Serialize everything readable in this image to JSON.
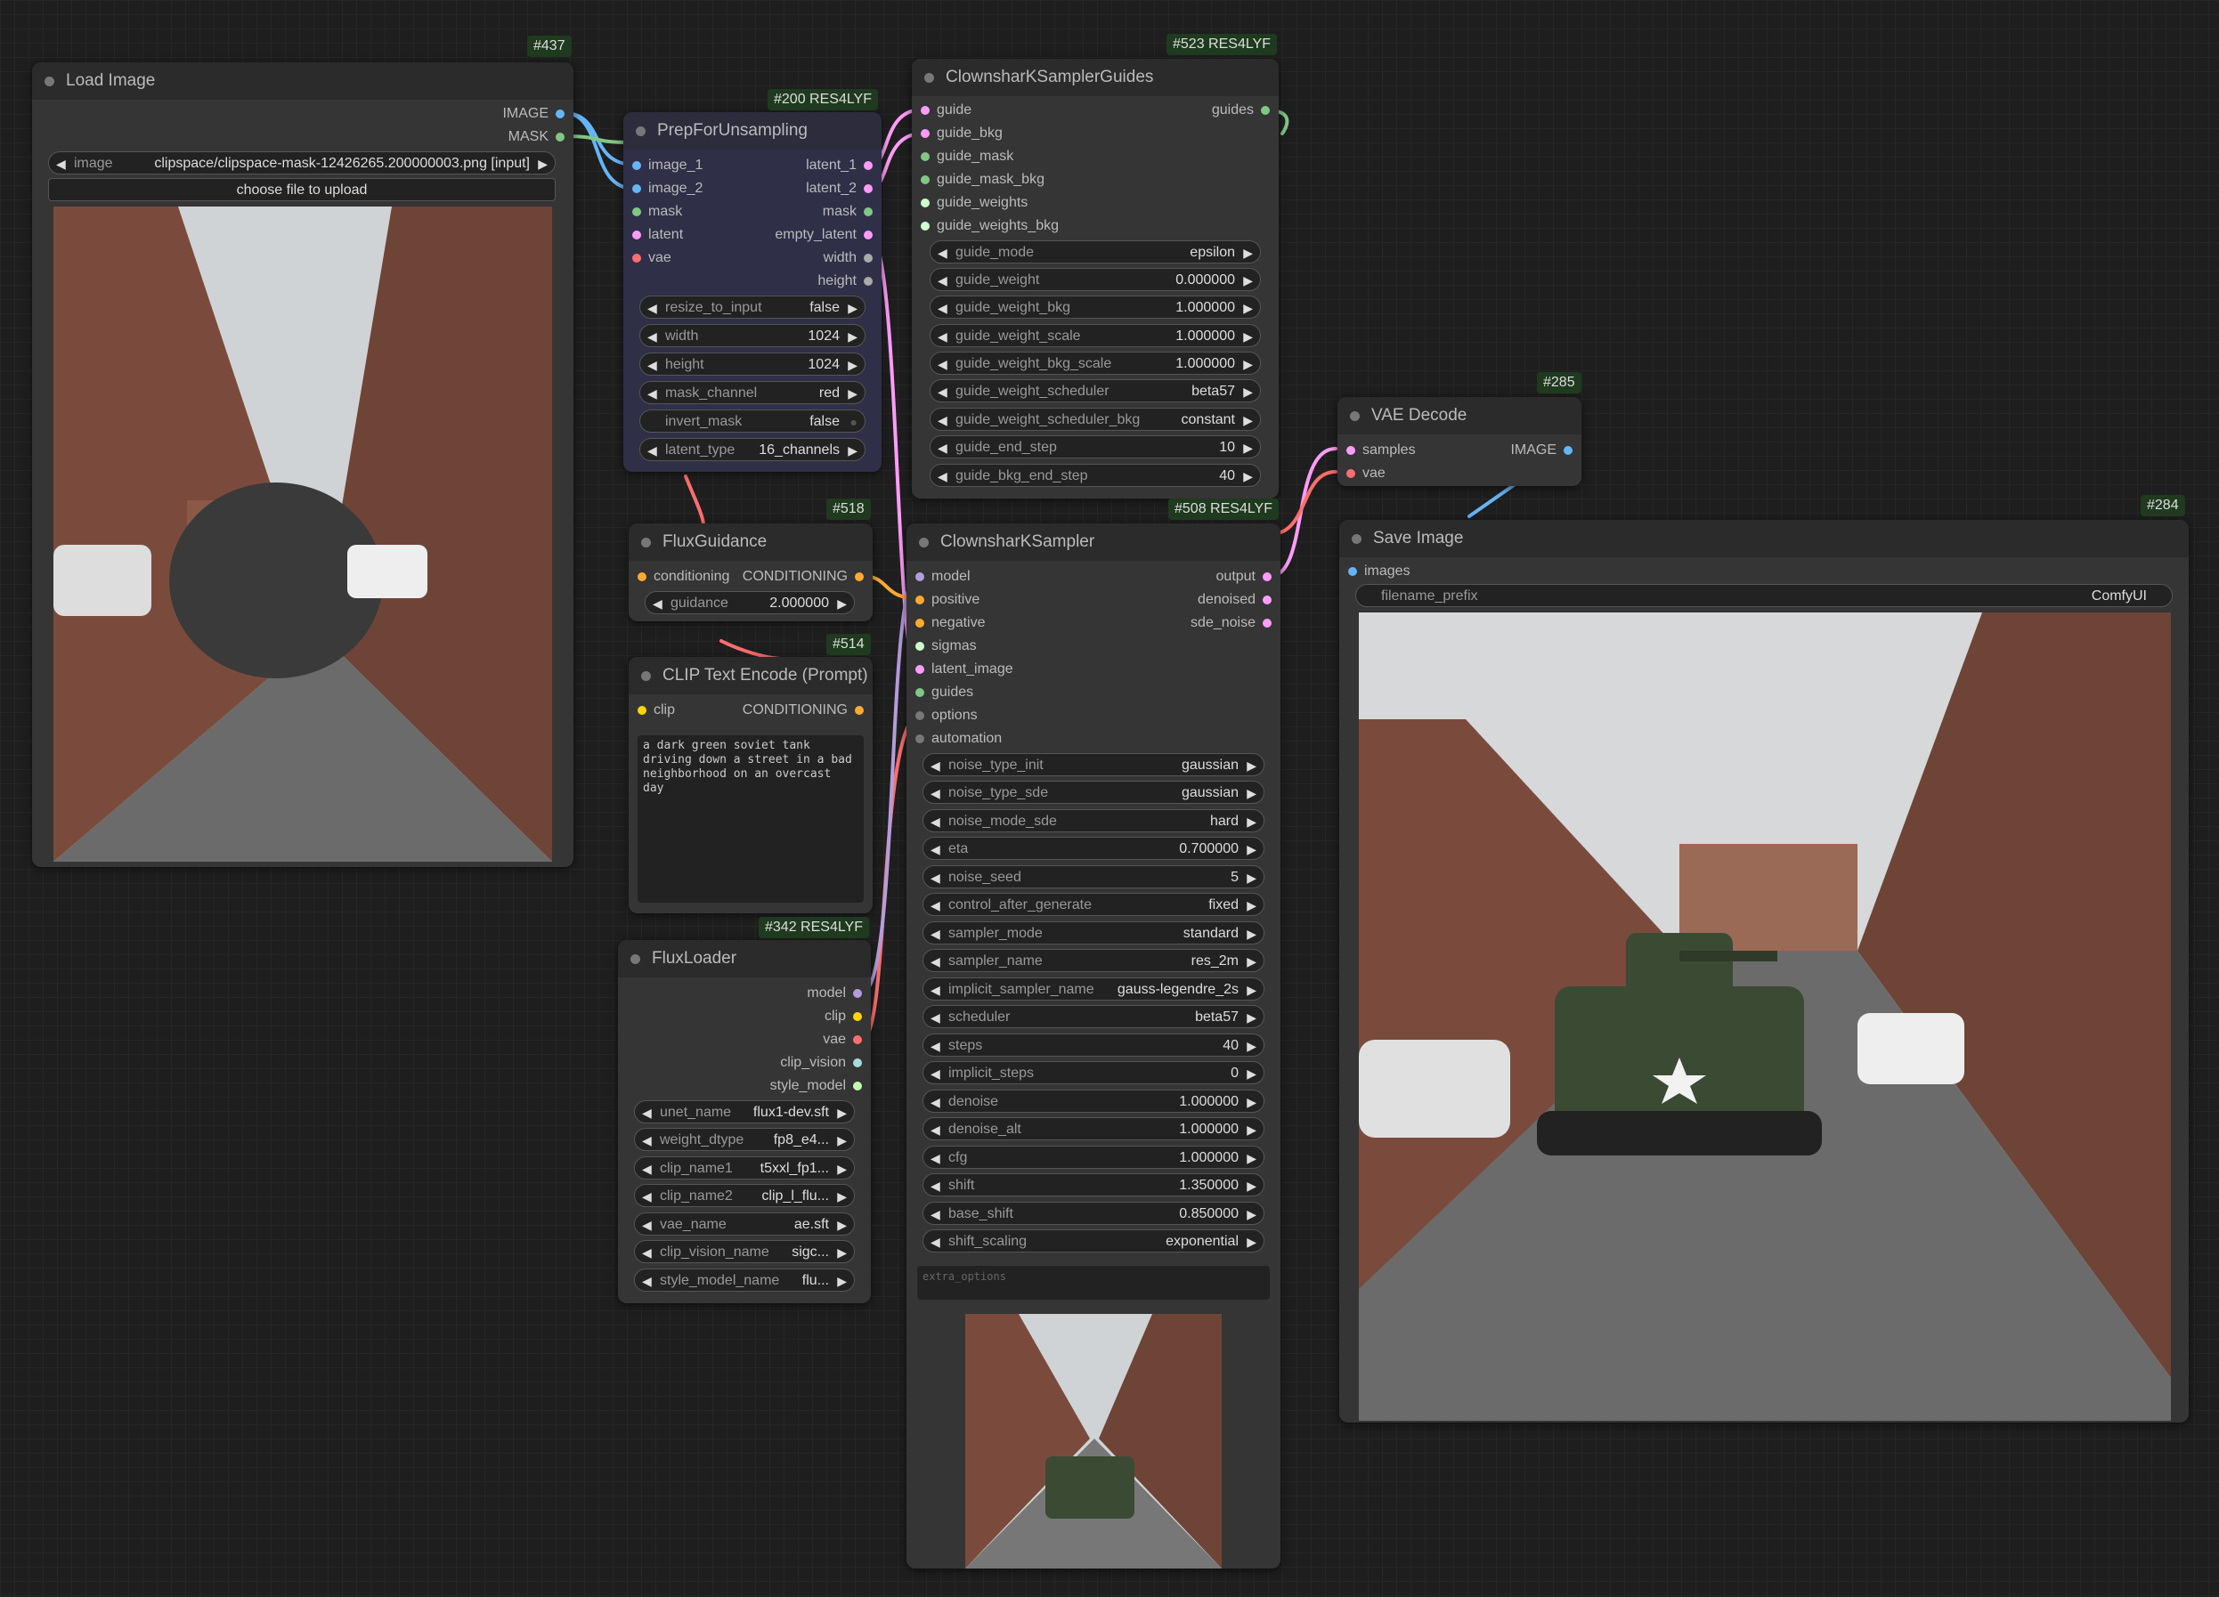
{
  "colors": {
    "image": "#64b5f6",
    "mask": "#81c784",
    "latent": "#ff9cf9",
    "vae": "#ff6e6e",
    "conditioning": "#ffa931",
    "clip": "#ffd500",
    "model": "#b39ddb",
    "sigmas": "#cdffcd",
    "guides": "#81c784",
    "options": "#777777",
    "clip_vision": "#a8dadc",
    "style_model": "#c2ffae"
  },
  "load_image": {
    "badge": "#437",
    "title": "Load Image",
    "out_image": "IMAGE",
    "out_mask": "MASK",
    "image_label": "image",
    "image_value": "clipspace/clipspace-mask-12426265.200000003.png [input]",
    "upload_label": "choose file to upload"
  },
  "prep": {
    "badge": "#200 RES4LYF",
    "title": "PrepForUnsampling",
    "inputs": [
      "image_1",
      "image_2",
      "mask",
      "latent",
      "vae"
    ],
    "outputs": [
      "latent_1",
      "latent_2",
      "mask",
      "empty_latent",
      "width",
      "height"
    ],
    "widgets": [
      {
        "label": "resize_to_input",
        "value": "false"
      },
      {
        "label": "width",
        "value": "1024"
      },
      {
        "label": "height",
        "value": "1024"
      },
      {
        "label": "mask_channel",
        "value": "red"
      },
      {
        "label": "invert_mask",
        "value": "false"
      },
      {
        "label": "latent_type",
        "value": "16_channels"
      }
    ]
  },
  "guides": {
    "badge": "#523 RES4LYF",
    "title": "ClownsharKSamplerGuides",
    "inputs": [
      "guide",
      "guide_bkg",
      "guide_mask",
      "guide_mask_bkg",
      "guide_weights",
      "guide_weights_bkg"
    ],
    "output": "guides",
    "widgets": [
      {
        "label": "guide_mode",
        "value": "epsilon"
      },
      {
        "label": "guide_weight",
        "value": "0.000000"
      },
      {
        "label": "guide_weight_bkg",
        "value": "1.000000"
      },
      {
        "label": "guide_weight_scale",
        "value": "1.000000"
      },
      {
        "label": "guide_weight_bkg_scale",
        "value": "1.000000"
      },
      {
        "label": "guide_weight_scheduler",
        "value": "beta57"
      },
      {
        "label": "guide_weight_scheduler_bkg",
        "value": "constant"
      },
      {
        "label": "guide_end_step",
        "value": "10"
      },
      {
        "label": "guide_bkg_end_step",
        "value": "40"
      }
    ]
  },
  "vae_decode": {
    "badge": "#285",
    "title": "VAE Decode",
    "in_samples": "samples",
    "in_vae": "vae",
    "out_image": "IMAGE"
  },
  "flux_guidance": {
    "badge": "#518",
    "title": "FluxGuidance",
    "in_conditioning": "conditioning",
    "out_conditioning": "CONDITIONING",
    "widget_label": "guidance",
    "widget_value": "2.000000"
  },
  "clip_text": {
    "badge": "#514",
    "title": "CLIP Text Encode (Prompt)",
    "in_clip": "clip",
    "out_conditioning": "CONDITIONING",
    "text": "a dark green soviet tank driving down a street in a bad neighborhood on an overcast day"
  },
  "sampler": {
    "badge": "#508 RES4LYF",
    "title": "ClownsharKSampler",
    "inputs": [
      "model",
      "positive",
      "negative",
      "sigmas",
      "latent_image",
      "guides",
      "options",
      "automation"
    ],
    "outputs": [
      "output",
      "denoised",
      "sde_noise"
    ],
    "widgets": [
      {
        "label": "noise_type_init",
        "value": "gaussian"
      },
      {
        "label": "noise_type_sde",
        "value": "gaussian"
      },
      {
        "label": "noise_mode_sde",
        "value": "hard"
      },
      {
        "label": "eta",
        "value": "0.700000"
      },
      {
        "label": "noise_seed",
        "value": "5"
      },
      {
        "label": "control_after_generate",
        "value": "fixed"
      },
      {
        "label": "sampler_mode",
        "value": "standard"
      },
      {
        "label": "sampler_name",
        "value": "res_2m"
      },
      {
        "label": "implicit_sampler_name",
        "value": "gauss-legendre_2s"
      },
      {
        "label": "scheduler",
        "value": "beta57"
      },
      {
        "label": "steps",
        "value": "40"
      },
      {
        "label": "implicit_steps",
        "value": "0"
      },
      {
        "label": "denoise",
        "value": "1.000000"
      },
      {
        "label": "denoise_alt",
        "value": "1.000000"
      },
      {
        "label": "cfg",
        "value": "1.000000"
      },
      {
        "label": "shift",
        "value": "1.350000"
      },
      {
        "label": "base_shift",
        "value": "0.850000"
      },
      {
        "label": "shift_scaling",
        "value": "exponential"
      }
    ],
    "extra_options_placeholder": "extra_options"
  },
  "flux_loader": {
    "badge": "#342 RES4LYF",
    "title": "FluxLoader",
    "outputs": [
      "model",
      "clip",
      "vae",
      "clip_vision",
      "style_model"
    ],
    "widgets": [
      {
        "label": "unet_name",
        "value": "flux1-dev.sft"
      },
      {
        "label": "weight_dtype",
        "value": "fp8_e4..."
      },
      {
        "label": "clip_name1",
        "value": "t5xxl_fp1..."
      },
      {
        "label": "clip_name2",
        "value": "clip_l_flu..."
      },
      {
        "label": "vae_name",
        "value": "ae.sft"
      },
      {
        "label": "clip_vision_name",
        "value": "sigc..."
      },
      {
        "label": "style_model_name",
        "value": "flu..."
      }
    ]
  },
  "save_image": {
    "badge": "#284",
    "title": "Save Image",
    "in_images": "images",
    "prefix_label": "filename_prefix",
    "prefix_value": "ComfyUI"
  }
}
